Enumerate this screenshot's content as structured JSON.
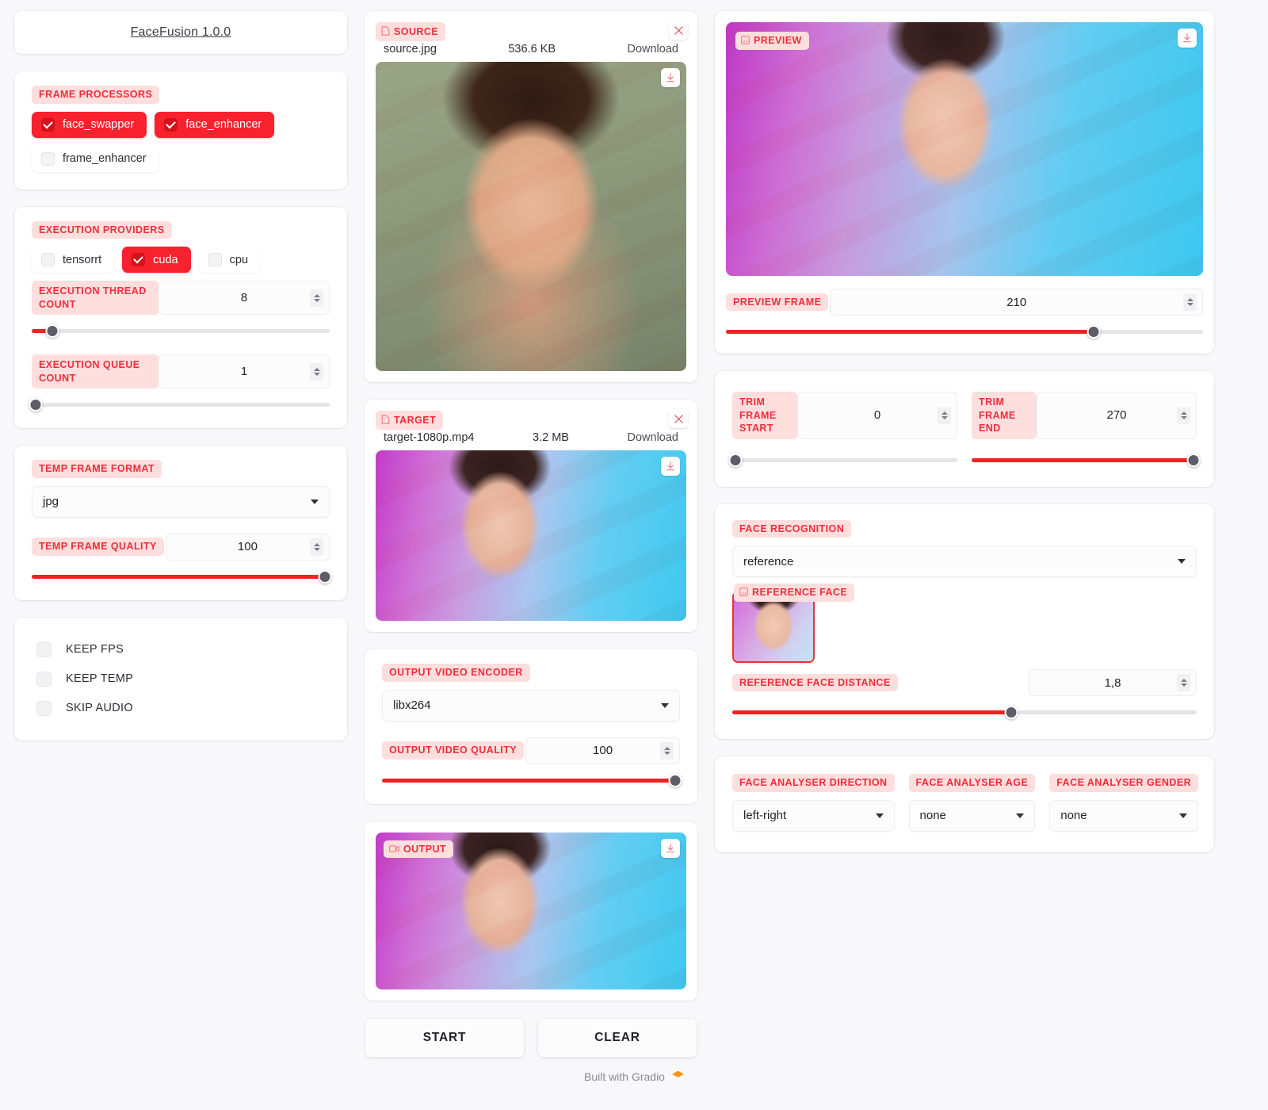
{
  "app": {
    "title": "FaceFusion 1.0.0",
    "accent": "#f02d3a",
    "label_bg": "#ffdede",
    "slider_fill": "#ef2222"
  },
  "left": {
    "frame_processors": {
      "label": "FRAME PROCESSORS",
      "options": [
        {
          "label": "face_swapper",
          "checked": true
        },
        {
          "label": "face_enhancer",
          "checked": true
        },
        {
          "label": "frame_enhancer",
          "checked": false
        }
      ]
    },
    "execution_providers": {
      "label": "EXECUTION PROVIDERS",
      "options": [
        {
          "label": "tensorrt",
          "checked": false
        },
        {
          "label": "cuda",
          "checked": true
        },
        {
          "label": "cpu",
          "checked": false
        }
      ]
    },
    "execution_thread_count": {
      "label": "EXECUTION THREAD COUNT",
      "value": "8",
      "percent": 7
    },
    "execution_queue_count": {
      "label": "EXECUTION QUEUE COUNT",
      "value": "1",
      "percent": 0
    },
    "temp_frame_format": {
      "label": "TEMP FRAME FORMAT",
      "value": "jpg"
    },
    "temp_frame_quality": {
      "label": "TEMP FRAME QUALITY",
      "value": "100",
      "percent": 100
    },
    "toggles": [
      {
        "label": "KEEP FPS",
        "checked": false
      },
      {
        "label": "KEEP TEMP",
        "checked": false
      },
      {
        "label": "SKIP AUDIO",
        "checked": false
      }
    ]
  },
  "middle": {
    "source": {
      "badge": "SOURCE",
      "badge_icon": "file-icon",
      "filename": "source.jpg",
      "filesize": "536.6 KB",
      "download_label": "Download"
    },
    "target": {
      "badge": "TARGET",
      "badge_icon": "file-icon",
      "filename": "target-1080p.mp4",
      "filesize": "3.2 MB",
      "download_label": "Download"
    },
    "output_video_encoder": {
      "label": "OUTPUT VIDEO ENCODER",
      "value": "libx264"
    },
    "output_video_quality": {
      "label": "OUTPUT VIDEO QUALITY",
      "value": "100",
      "percent": 100
    },
    "output": {
      "badge": "OUTPUT",
      "badge_icon": "video-icon"
    },
    "start_label": "START",
    "clear_label": "CLEAR"
  },
  "right": {
    "preview": {
      "badge": "PREVIEW",
      "badge_icon": "image-icon"
    },
    "preview_frame": {
      "label": "PREVIEW FRAME",
      "value": "210",
      "percent": 77
    },
    "trim_frame_start": {
      "label": "TRIM FRAME START",
      "value": "0",
      "percent": 0
    },
    "trim_frame_end": {
      "label": "TRIM FRAME END",
      "value": "270",
      "percent": 100
    },
    "face_recognition": {
      "label": "FACE RECOGNITION",
      "value": "reference"
    },
    "reference_face": {
      "badge": "REFERENCE FACE",
      "badge_icon": "image-icon"
    },
    "reference_face_distance": {
      "label": "REFERENCE FACE DISTANCE",
      "value": "1,8",
      "percent": 60
    },
    "face_analyser_direction": {
      "label": "FACE ANALYSER DIRECTION",
      "value": "left-right"
    },
    "face_analyser_age": {
      "label": "FACE ANALYSER AGE",
      "value": "none"
    },
    "face_analyser_gender": {
      "label": "FACE ANALYSER GENDER",
      "value": "none"
    }
  },
  "footer": {
    "text": "Built with Gradio",
    "logo_icon": "gradio-logo-icon"
  }
}
